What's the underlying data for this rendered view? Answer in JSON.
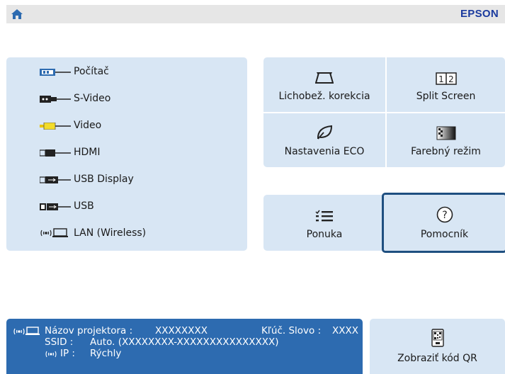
{
  "brand": "EPSON",
  "header": {
    "home_icon": "home-icon"
  },
  "sources": [
    {
      "label": "Počítač",
      "icon": "computer-port-icon"
    },
    {
      "label": "S-Video",
      "icon": "s-video-port-icon"
    },
    {
      "label": "Video",
      "icon": "video-port-icon"
    },
    {
      "label": "HDMI",
      "icon": "hdmi-port-icon"
    },
    {
      "label": "USB Display",
      "icon": "usb-display-port-icon"
    },
    {
      "label": "USB",
      "icon": "usb-port-icon"
    },
    {
      "label": "LAN (Wireless)",
      "icon": "wireless-lan-icon"
    }
  ],
  "functions": {
    "keystone": {
      "label": "Lichobež. korekcia",
      "icon": "keystone-icon"
    },
    "split": {
      "label": "Split Screen",
      "icon": "split-screen-icon",
      "glyph": "1 2"
    },
    "eco": {
      "label": "Nastavenia ECO",
      "icon": "eco-leaf-icon"
    },
    "color": {
      "label": "Farebný režim",
      "icon": "color-mode-icon"
    },
    "menu": {
      "label": "Ponuka",
      "icon": "menu-list-icon"
    },
    "help": {
      "label": "Pomocník",
      "icon": "help-icon"
    }
  },
  "info": {
    "projector_name_label": "Názov projektora :",
    "projector_name_value": "XXXXXXXX",
    "keyword_label": "Kľúč. Slovo :",
    "keyword_value": "XXXX",
    "ssid_label": "SSID  :",
    "ssid_value": "Auto. (XXXXXXXX-XXXXXXXXXXXXXXX)",
    "ip_label": "IP  :",
    "ip_value": "Rýchly"
  },
  "qr": {
    "label": "Zobraziť kód QR",
    "icon": "qr-code-icon"
  },
  "colors": {
    "panel": "#d8e6f4",
    "info_bg": "#2d6bb0",
    "brand": "#1a3a9e",
    "selection": "#1f4f80"
  }
}
